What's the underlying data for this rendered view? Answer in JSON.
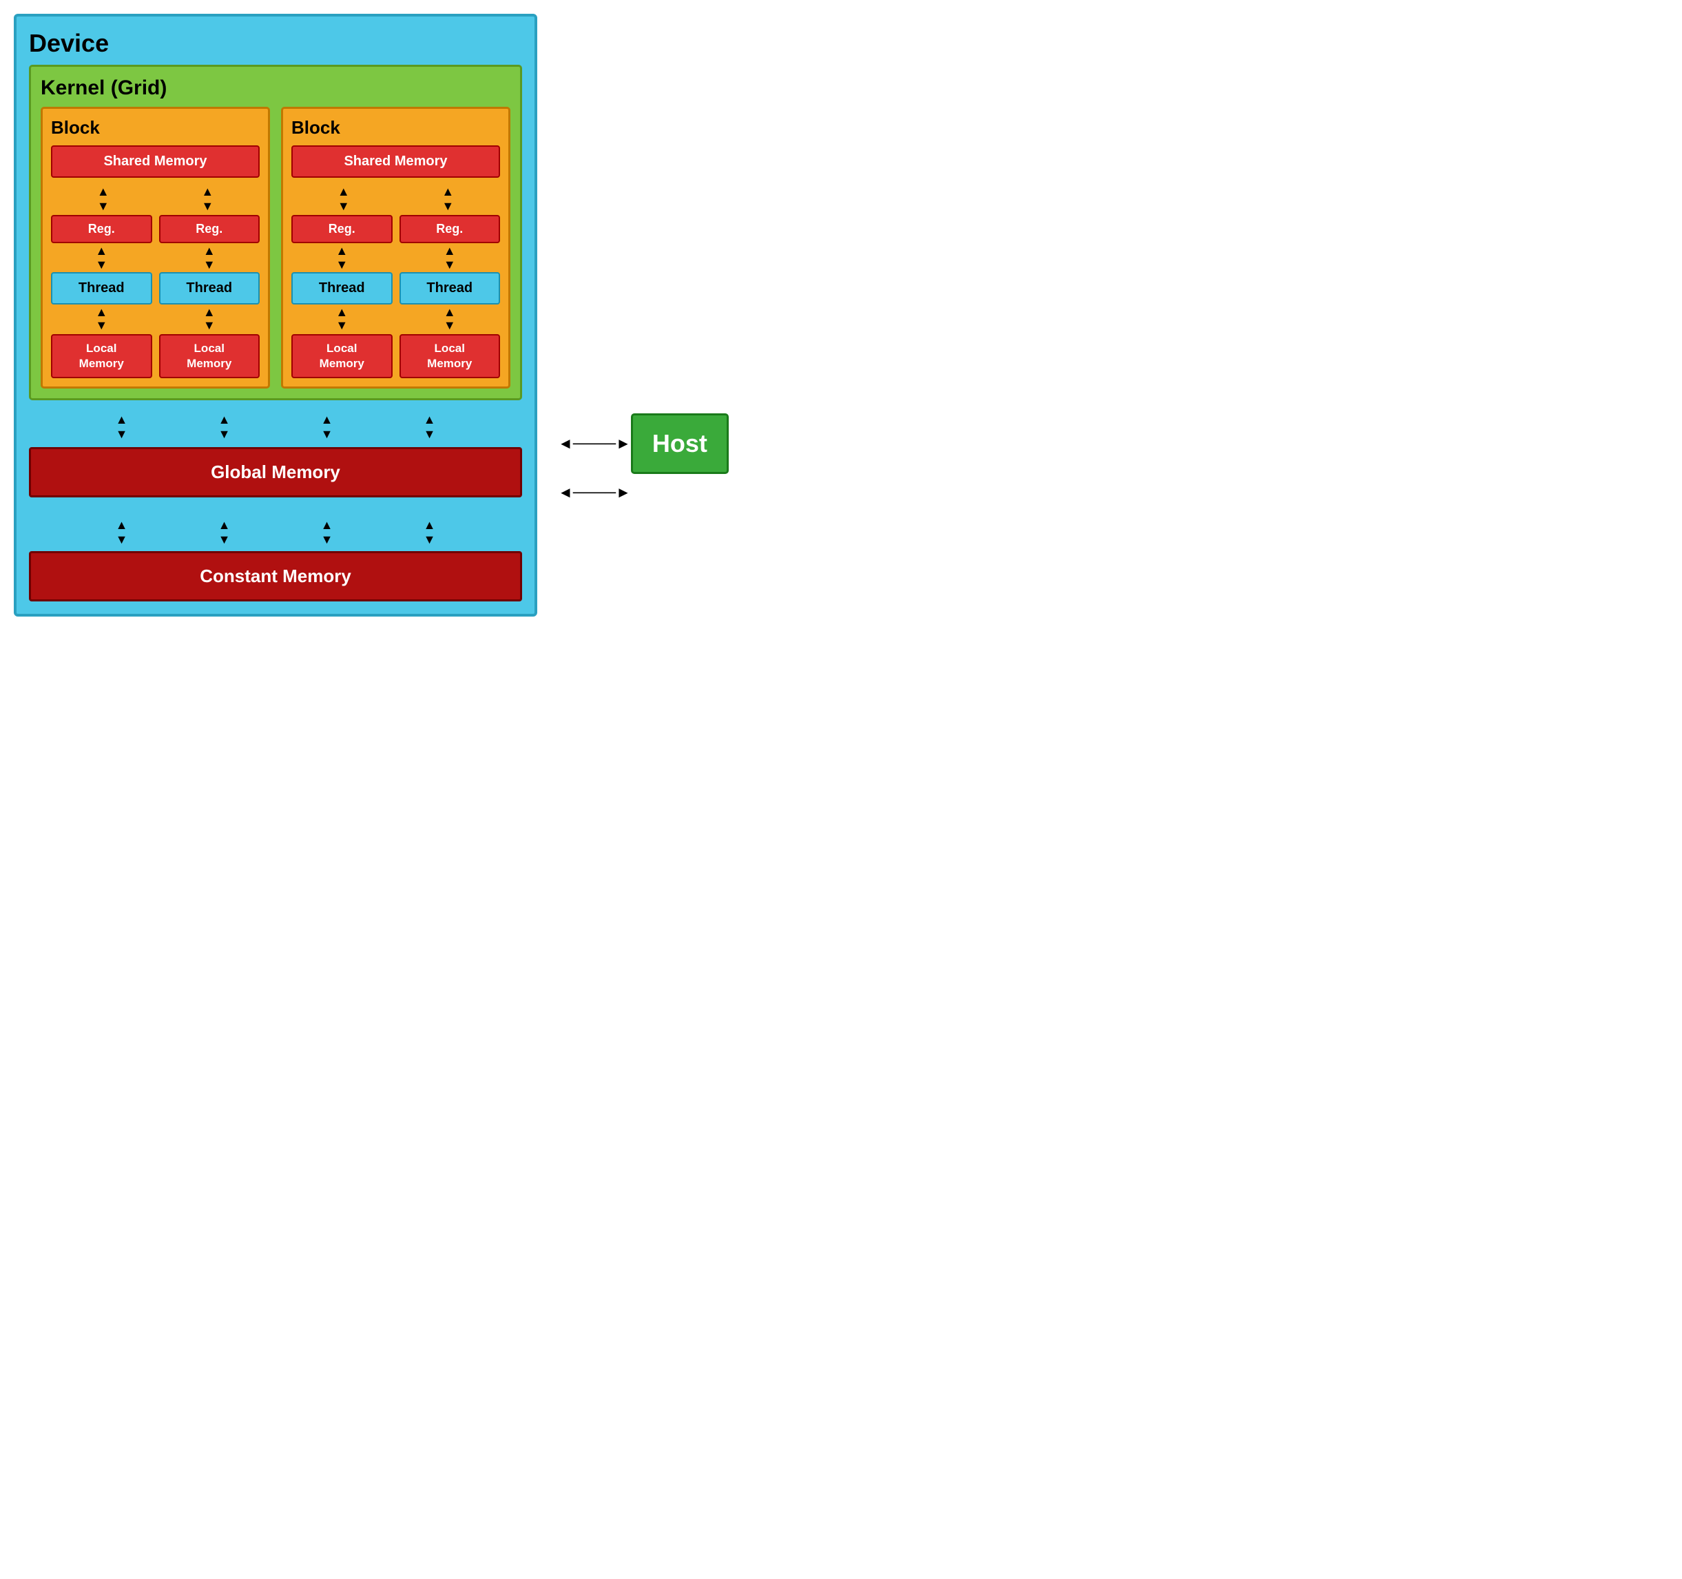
{
  "device": {
    "label": "Device"
  },
  "kernel": {
    "label": "Kernel (Grid)"
  },
  "blocks": [
    {
      "label": "Block",
      "shared_memory": "Shared Memory",
      "threads": [
        {
          "reg": "Reg.",
          "thread": "Thread",
          "local_memory": "Local\nMemory"
        },
        {
          "reg": "Reg.",
          "thread": "Thread",
          "local_memory": "Local\nMemory"
        }
      ]
    },
    {
      "label": "Block",
      "shared_memory": "Shared Memory",
      "threads": [
        {
          "reg": "Reg.",
          "thread": "Thread",
          "local_memory": "Local\nMemory"
        },
        {
          "reg": "Reg.",
          "thread": "Thread",
          "local_memory": "Local\nMemory"
        }
      ]
    }
  ],
  "global_memory": "Global Memory",
  "constant_memory": "Constant Memory",
  "host": "Host",
  "arrows": {
    "up": "▲",
    "down": "▼",
    "left": "◄",
    "right": "►",
    "double_vert": "▲\n▼",
    "double_horiz": "◄►"
  }
}
